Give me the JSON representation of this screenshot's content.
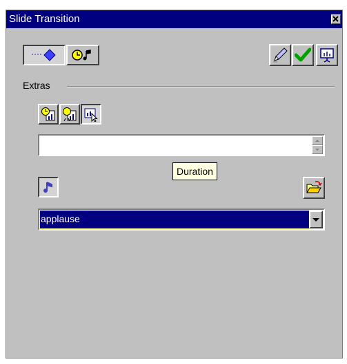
{
  "window": {
    "title": "Slide Transition"
  },
  "toolbar": {
    "effects_icon": "diamond-icon",
    "timing_sound_icon": "clock-note-icon",
    "apply_icon": "pencil-icon",
    "ok_icon": "checkmark-icon",
    "preview_icon": "slideshow-icon"
  },
  "extras": {
    "label": "Extras",
    "mode_icons": [
      "clock-chart-icon",
      "timer-chart-icon",
      "pointer-chart-icon"
    ],
    "duration_value": "",
    "duration_tooltip": "Duration"
  },
  "sound": {
    "icon": "music-note-icon",
    "open_icon": "open-folder-icon",
    "selected": "applause"
  },
  "colors": {
    "titlebar": "#000080",
    "face": "#c0c0c0",
    "selection": "#000080"
  }
}
